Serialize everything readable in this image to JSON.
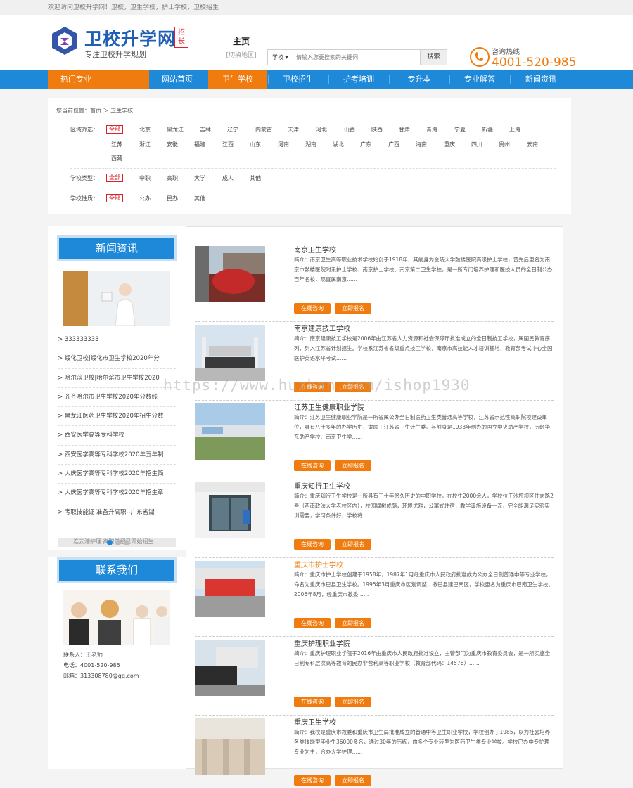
{
  "topbar": {
    "text": "欢迎访问卫校升学网！卫校，卫生学校，护士学校，卫校招生"
  },
  "logo": {
    "title": "卫校升学网",
    "badge": "招长",
    "subtitle": "专注卫校升学规划"
  },
  "home": {
    "label": "主页",
    "switch": "[切换地区]"
  },
  "search": {
    "select": "学校",
    "placeholder": "请输入您要搜索的关键词",
    "button": "搜索"
  },
  "hotline": {
    "label": "咨询热线",
    "number": "4001-520-985"
  },
  "nav": {
    "items": [
      "热门专业",
      "网站首页",
      "卫生学校",
      "卫校招生",
      "护考培训",
      "专升本",
      "专业解答",
      "新闻资讯"
    ]
  },
  "filter": {
    "breadcrumb": "您当前位置：首页 ＞ 卫生学校",
    "region_label": "区域筛选：",
    "regions_row1": [
      "全部",
      "北京",
      "黑龙江",
      "吉林",
      "辽宁",
      "内蒙古",
      "天津",
      "河北",
      "山西",
      "陕西",
      "甘肃",
      "青海",
      "宁夏",
      "新疆",
      "上海"
    ],
    "regions_row2": [
      "江苏",
      "浙江",
      "安徽",
      "福建",
      "江西",
      "山东",
      "河南",
      "湖南",
      "湖北",
      "广东",
      "广西",
      "海南",
      "重庆",
      "四川",
      "贵州",
      "云南"
    ],
    "regions_row3": [
      "西藏"
    ],
    "type_label": "学校类型：",
    "types": [
      "全部",
      "中职",
      "高职",
      "大学",
      "成人",
      "其他"
    ],
    "nature_label": "学校性质：",
    "natures": [
      "全部",
      "公办",
      "民办",
      "其他"
    ]
  },
  "sidebar": {
    "news_title": "新闻资讯",
    "news": [
      "> 333333333",
      "> 绥化卫校|绥化市卫生学校2020年分",
      "> 哈尔滨卫校|哈尔滨市卫生学校2020",
      "> 齐齐哈尔市卫生学校2020年分数线",
      "> 黑龙江医药卫生学校2020年招生分数",
      "> 西安医学高等专科学校",
      "> 西安医学高等专科学校2020年五年制",
      "> 大庆医学高等专科学校2020年招生简",
      "> 大庆医学高等专科学校2020年招生章",
      "> 考取技能证 准备升高职--广东省湖"
    ],
    "slider_text": "连云港护理 高职单招已开始招生",
    "contact_title": "联系我们",
    "contact_name": "联系人：王老师",
    "contact_phone": "电话：4001-520-985",
    "contact_email": "邮箱：313308780@qq.com"
  },
  "schools": [
    {
      "name": "南京卫生学校",
      "highlight": false,
      "desc": "简介：南京卫生高等职业技术学校始创于1918年，其前身为金陵大学鼓楼医院高级护士学校，曾先后更名为南京市鼓楼医院附设护士学校、南京护士学校、南京第二卫生学校，是一所专门培养护理和医技人员的全日制公办百年名校，现直属南京……"
    },
    {
      "name": "南京建康技工学校",
      "highlight": false,
      "desc": "简介：南京建康技工学校是2006年由江苏省人力资源和社会保障厅批准成立的全日制技工学校，属国民教育序列，列入江苏省计划招生。学校系江苏省省级重点技工学校，南京市高技能人才培训基地，教育部考试中心全国医护英语水平考试……"
    },
    {
      "name": "江苏卫生健康职业学院",
      "highlight": false,
      "desc": "简介：江苏卫生健康职业学院是一所省属公办全日制医药卫生类普通高等学校，江苏省示范性高职院校建设单位，具有八十多年的办学历史，隶属于江苏省卫生计生委。其前身是1933年创办的国立中央助产学校，历经华东助产学校、南京卫生学……"
    },
    {
      "name": "重庆知行卫生学校",
      "highlight": false,
      "desc": "简介：重庆知行卫生学校是一所具有三十年悠久历史的中职学校，在校生2000余人，学校位于沙坪坝区住志路2号（西南政法大学老校区内），校园绿树成荫，环境优雅，公寓式住宿，教学设施设备一流，完全能满足实验实训需要，学习条件好，学校将……"
    },
    {
      "name": "重庆市护士学校",
      "highlight": true,
      "desc": "简介：重庆市护士学校创建于1958年，1987年1月经重庆市人民政府批准成为公办全日制普通中等专业学校，命名为重庆市巴县卫生学校。1995年3月重庆市区划调整，撤巴县建巴南区，学校更名为重庆市巴南卫生学校。2006年8月，经重庆市教委……"
    },
    {
      "name": "重庆护理职业学院",
      "highlight": false,
      "desc": "简介：重庆护理职业学院于2016年由重庆市人民政府批准设立，主管部门为重庆市教育委员会，是一所实施全日制专科层次高等教育的民办非营利高等职业学校（教育部代码：14576）……"
    },
    {
      "name": "重庆卫生学校",
      "highlight": false,
      "desc": "简介：我校是重庆市教委和重庆市卫生局批准成立的普通中等卫生职业学校，学校创办于1985，以为社会培养各类技能型毕业生36000多名，通过30年的历练，由多个专业转型为医药卫生类专业学校。学校已办中专护理专业为主，合办大学护理……"
    }
  ],
  "buttons": {
    "consult": "在线咨询",
    "apply": "立即报名"
  },
  "watermark": "https://www.huzhan.com/ishop1930",
  "colors": {
    "brand_blue": "#1e88d9",
    "accent_orange": "#f07c10",
    "active_red": "#d9232d"
  }
}
